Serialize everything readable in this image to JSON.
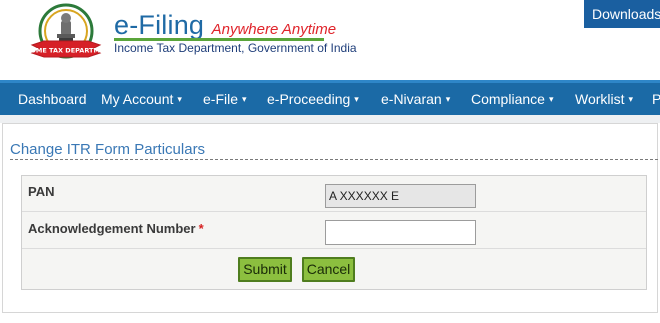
{
  "header": {
    "brand_title": "e-Filing",
    "brand_tagline": "Anywhere Anytime",
    "department": "Income Tax Department, Government of India",
    "emblem_text": "INCOME TAX DEPARTMENT",
    "downloads_label": "Downloads"
  },
  "nav": {
    "items": [
      {
        "label": "Dashboard",
        "has_dropdown": false
      },
      {
        "label": "My Account",
        "has_dropdown": true
      },
      {
        "label": "e-File",
        "has_dropdown": true
      },
      {
        "label": "e-Proceeding",
        "has_dropdown": true
      },
      {
        "label": "e-Nivaran",
        "has_dropdown": true
      },
      {
        "label": "Compliance",
        "has_dropdown": true
      },
      {
        "label": "Worklist",
        "has_dropdown": true
      },
      {
        "label": "P",
        "has_dropdown": false
      }
    ]
  },
  "page": {
    "title": "Change ITR Form Particulars"
  },
  "form": {
    "pan_label": "PAN",
    "pan_value": "A XXXXXX E",
    "ack_label": "Acknowledgement Number",
    "ack_required_mark": "*",
    "ack_value": "",
    "submit_label": "Submit",
    "cancel_label": "Cancel"
  },
  "colors": {
    "nav_bg": "#1b6aa6",
    "brand_blue": "#1f6aa5",
    "tagline_red": "#e0242b",
    "button_green": "#8cbf3f"
  }
}
